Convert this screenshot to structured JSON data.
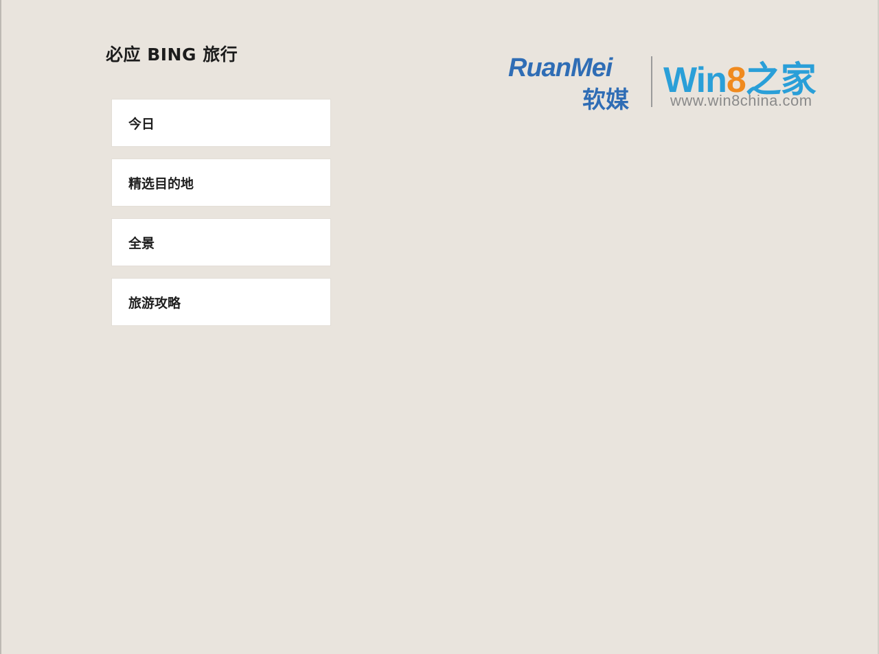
{
  "app": {
    "title": "必应 BING 旅行"
  },
  "nav": {
    "items": [
      {
        "label": "今日"
      },
      {
        "label": "精选目的地"
      },
      {
        "label": "全景"
      },
      {
        "label": "旅游攻略"
      }
    ]
  },
  "watermark": {
    "brand_latin": "RuanMei",
    "brand_cn": "软媒",
    "site_prefix": "Win",
    "site_digit": "8",
    "site_suffix": "之家",
    "url": "www.win8china.com"
  },
  "colors": {
    "background": "#e9e4dd",
    "card": "#ffffff",
    "text": "#1e1e1e",
    "ruanmei_blue": "#2f6db5",
    "win8_blue": "#2a9fd8",
    "win8_orange": "#f08a1e"
  }
}
